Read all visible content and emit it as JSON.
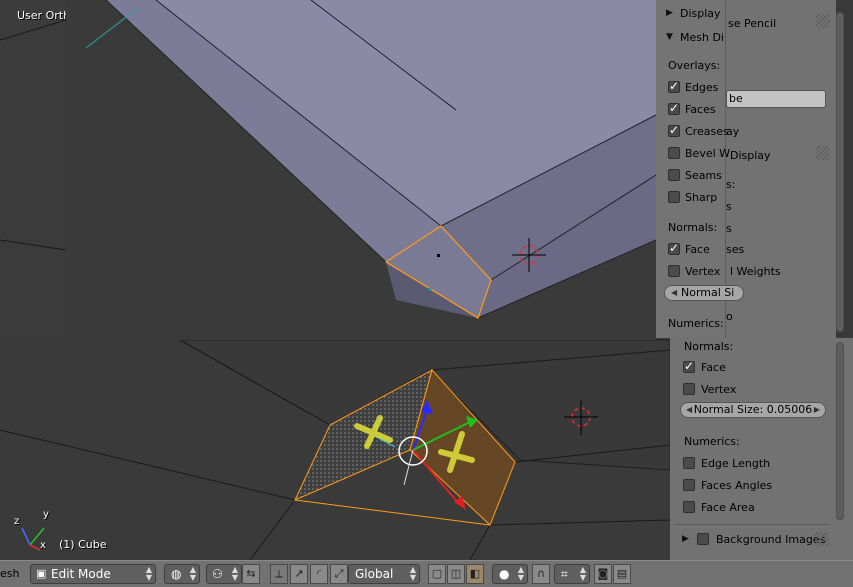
{
  "viewport_top": {
    "view_label": "User Orth"
  },
  "viewport_bottom": {
    "object_label": "(1) Cube"
  },
  "axes": {
    "x": "x",
    "y": "y",
    "z": "z"
  },
  "back_panel": {
    "grease_pencil_label": "se Pencil",
    "name_value": "be",
    "display_label": "ay",
    "mesh_display_label": "Display",
    "partial_rows": [
      "s:",
      "s",
      "s",
      "ses",
      "l Weights",
      "o"
    ]
  },
  "front_panel": {
    "display_label": "Display",
    "mesh_display_label": "Mesh Di",
    "overlays_label": "Overlays:",
    "overlays": [
      {
        "label": "Edges",
        "checked": true
      },
      {
        "label": "Faces",
        "checked": true
      },
      {
        "label": "Creases",
        "checked": true
      },
      {
        "label": "Bevel W",
        "checked": false
      },
      {
        "label": "Seams",
        "checked": false
      },
      {
        "label": "Sharp",
        "checked": false
      }
    ],
    "normals_label": "Normals:",
    "normals": [
      {
        "label": "Face",
        "checked": true
      },
      {
        "label": "Vertex",
        "checked": false
      }
    ],
    "normal_size_label": "Normal Si",
    "numerics_label": "Numerics:"
  },
  "right_panel": {
    "normals_label": "Normals:",
    "normals": [
      {
        "label": "Face",
        "checked": true
      },
      {
        "label": "Vertex",
        "checked": false
      }
    ],
    "normal_size_label": "Normal Size: 0.05006",
    "numerics_label": "Numerics:",
    "numerics": [
      {
        "label": "Edge Length",
        "checked": false
      },
      {
        "label": "Faces Angles",
        "checked": false
      },
      {
        "label": "Face Area",
        "checked": false
      }
    ],
    "background_images_label": "Background Images"
  },
  "header": {
    "menu_label": "esh",
    "mode_label": "Edit Mode",
    "orientation_label": "Global"
  },
  "colors": {
    "accent_orange": "#ff9b1a",
    "viewport_bg": "#3a3a3a",
    "panel_bg": "#727272",
    "cube_face": "#8a8aa6"
  }
}
